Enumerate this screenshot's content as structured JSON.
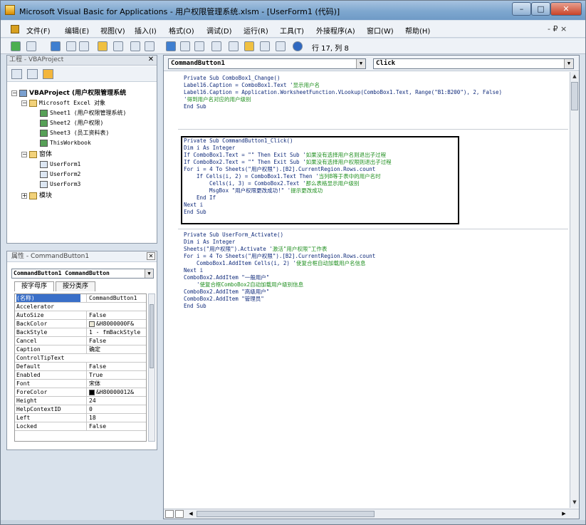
{
  "window": {
    "title": "Microsoft Visual Basic for Applications - 用户权限管理系统.xlsm - [UserForm1 (代码)]",
    "min": "–",
    "max": "□",
    "close": "✕"
  },
  "menu": {
    "items": [
      "文件(F)",
      "编辑(E)",
      "视图(V)",
      "插入(I)",
      "格式(O)",
      "调试(D)",
      "运行(R)",
      "工具(T)",
      "外接程序(A)",
      "窗口(W)",
      "帮助(H)"
    ],
    "controls": "- ₽ ×"
  },
  "toolbar": {
    "position": "行 17, 列 8"
  },
  "project": {
    "title": "工程 - VBAProject",
    "close": "✕",
    "tree": [
      {
        "toggle": "−",
        "label": "VBAProject (用户权限管理系统",
        "mono": false
      },
      {
        "toggle": "−",
        "label": "Microsoft Excel 对象",
        "mono": true
      },
      {
        "toggle": "",
        "label": "Sheet1 (用户权限管理系统)",
        "mono": true
      },
      {
        "toggle": "",
        "label": "Sheet2 (用户权限)",
        "mono": true
      },
      {
        "toggle": "",
        "label": "Sheet3 (员工资料表)",
        "mono": true
      },
      {
        "toggle": "",
        "label": "ThisWorkbook",
        "mono": true
      },
      {
        "toggle": "−",
        "label": "窗体",
        "mono": false
      },
      {
        "toggle": "",
        "label": "UserForm1",
        "mono": true
      },
      {
        "toggle": "",
        "label": "UserForm2",
        "mono": true
      },
      {
        "toggle": "",
        "label": "UserForm3",
        "mono": true
      },
      {
        "toggle": "+",
        "label": "模块",
        "mono": false
      }
    ]
  },
  "properties": {
    "title": "属性 - CommandButton1",
    "close": "✕",
    "object": "CommandButton1 CommandButton",
    "tabs": [
      "按字母序",
      "按分类序"
    ],
    "rows": [
      {
        "k": "(名称)",
        "v": "CommandButton1",
        "sel": true
      },
      {
        "k": "Accelerator",
        "v": ""
      },
      {
        "k": "AutoSize",
        "v": "False"
      },
      {
        "k": "BackColor",
        "v": "&H8000000F&",
        "swatch": "#ece9d8"
      },
      {
        "k": "BackStyle",
        "v": "1 - fmBackStyle"
      },
      {
        "k": "Cancel",
        "v": "False"
      },
      {
        "k": "Caption",
        "v": "确定"
      },
      {
        "k": "ControlTipText",
        "v": ""
      },
      {
        "k": "Default",
        "v": "False"
      },
      {
        "k": "Enabled",
        "v": "True"
      },
      {
        "k": "Font",
        "v": "宋体"
      },
      {
        "k": "ForeColor",
        "v": "&H80000012&",
        "swatch": "#000000"
      },
      {
        "k": "Height",
        "v": "24"
      },
      {
        "k": "HelpContextID",
        "v": "0"
      },
      {
        "k": "Left",
        "v": "18"
      },
      {
        "k": "Locked",
        "v": "False"
      }
    ]
  },
  "code": {
    "object_combo": "CommandButton1",
    "proc_combo": "Click",
    "lines": [
      {
        "t": "Private Sub ComboBox1_Change()",
        "c": "",
        "indent": 0
      },
      {
        "t": "Label16.Caption = ComboBox1.Text '",
        "c": "显示用户名",
        "indent": 0
      },
      {
        "t": "Label16.Caption = Application.WorksheetFunction.VLookup(ComboBox1.Text, Range(\"B1:B200\"), 2, False)",
        "c": "",
        "indent": 0
      },
      {
        "t": "'",
        "c": "得到用户名对应的用户级别",
        "indent": 0
      },
      {
        "t": "End Sub",
        "c": "",
        "indent": 0
      },
      {
        "t": "Private Sub CommandButton1_Click()",
        "c": "",
        "indent": 0
      },
      {
        "t": "Dim i As Integer",
        "c": "",
        "indent": 0
      },
      {
        "t": "If ComboBox1.Text = \"\" Then Exit Sub '",
        "c": "如果没有选择用户名则退出子过程",
        "indent": 0
      },
      {
        "t": "If ComboBox2.Text = \"\" Then Exit Sub '",
        "c": "如果没有选择用户权限则退出子过程",
        "indent": 0
      },
      {
        "t": "For i = 4 To Sheets(\"用户权限\").[B2].CurrentRegion.Rows.count",
        "c": "",
        "indent": 0
      },
      {
        "t": "If Cells(i, 2) = ComboBox1.Text Then '",
        "c": "当列B等于表中的用户名时",
        "indent": 1
      },
      {
        "t": "Cells(i, 3) = ComboBox2.Text '",
        "c": "那么表格显示用户级别",
        "indent": 2
      },
      {
        "t": "MsgBox \"用户权限更改成功!\" '",
        "c": "提示更改成功",
        "indent": 2
      },
      {
        "t": "End If",
        "c": "",
        "indent": 1
      },
      {
        "t": "Next i",
        "c": "",
        "indent": 0
      },
      {
        "t": "End Sub",
        "c": "",
        "indent": 0
      },
      {
        "t": "Private Sub UserForm_Activate()",
        "c": "",
        "indent": 0
      },
      {
        "t": "Dim i As Integer",
        "c": "",
        "indent": 0
      },
      {
        "t": "Sheets(\"用户权限\").Activate '",
        "c": "激活\"用户权限\"工作表",
        "indent": 0
      },
      {
        "t": "For i = 4 To Sheets(\"用户权限\").[B2].CurrentRegion.Rows.count",
        "c": "",
        "indent": 0
      },
      {
        "t": "ComboBox1.AddItem Cells(i, 2) '",
        "c": "使复合框自动加载用户名信息",
        "indent": 1
      },
      {
        "t": "Next i",
        "c": "",
        "indent": 0
      },
      {
        "t": "ComboBox2.AddItem \"一般用户\"",
        "c": "",
        "indent": 0
      },
      {
        "t": "'",
        "c": "使复合框ComboBox2自动加载用户级别信息",
        "indent": 1
      },
      {
        "t": "ComboBox2.AddItem \"高级用户\"",
        "c": "",
        "indent": 0
      },
      {
        "t": "ComboBox2.AddItem \"管理员\"",
        "c": "",
        "indent": 0
      },
      {
        "t": "End Sub",
        "c": "",
        "indent": 0
      }
    ]
  }
}
